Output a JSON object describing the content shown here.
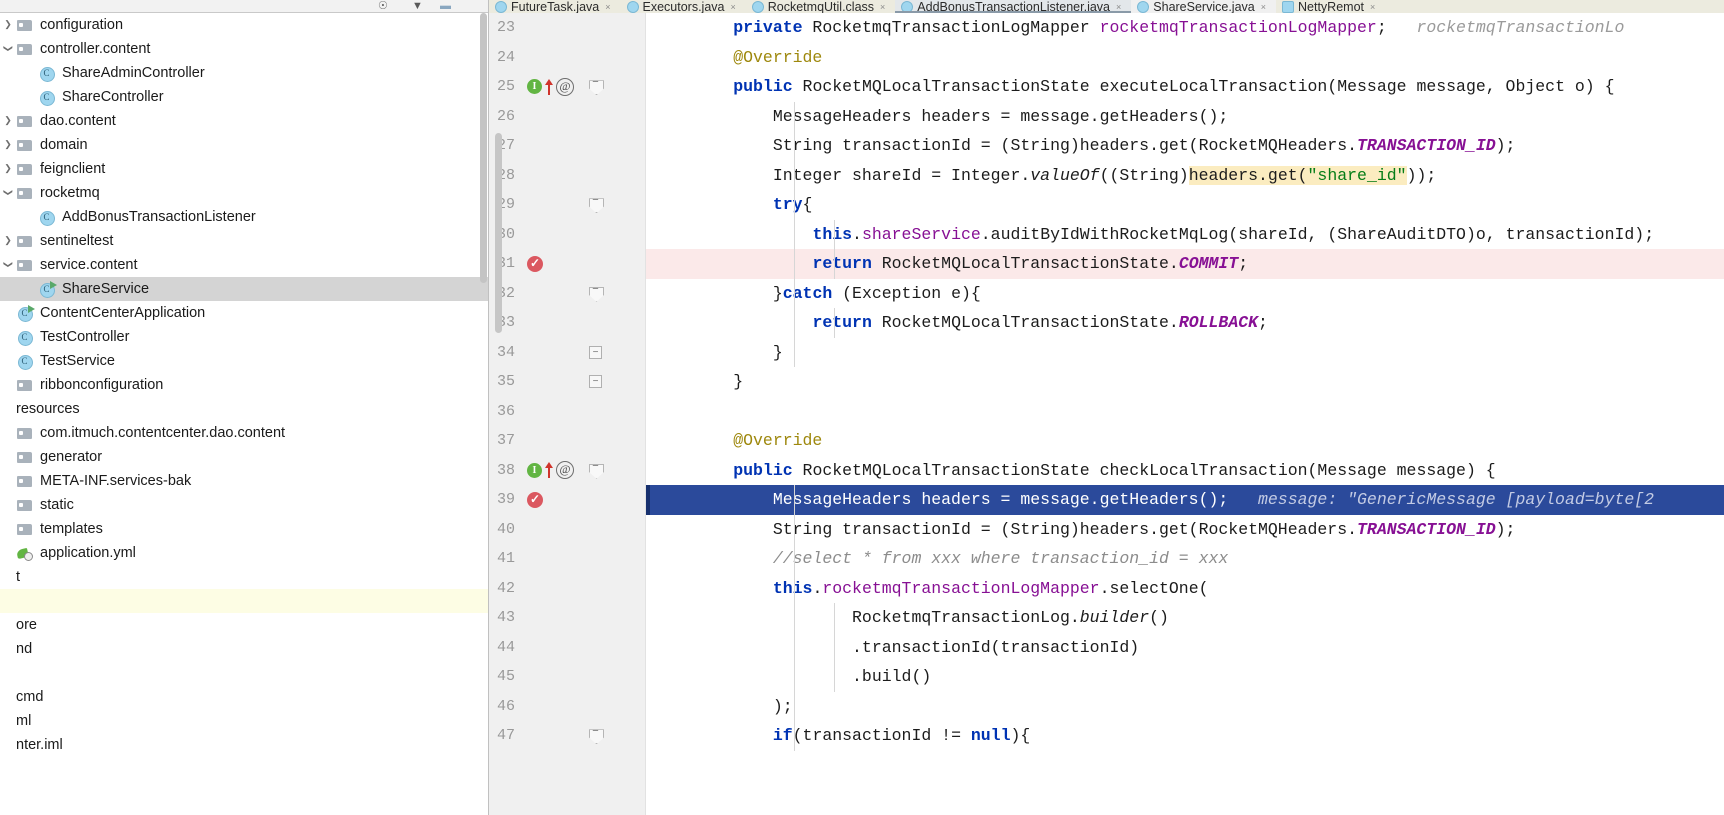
{
  "sidebar": {
    "toolstrip_icons": [
      "collapse-all-icon",
      "settings-icon",
      "hide-icon"
    ],
    "tree": [
      {
        "label": "configuration",
        "icon": "folder-icon",
        "arrow": "right",
        "indent": 1,
        "state": "collapsed"
      },
      {
        "label": "controller.content",
        "icon": "folder-icon",
        "arrow": "down",
        "indent": 1,
        "state": "expanded"
      },
      {
        "label": "ShareAdminController",
        "icon": "class-icon",
        "arrow": "none",
        "indent": 2,
        "state": "leaf"
      },
      {
        "label": "ShareController",
        "icon": "class-icon",
        "arrow": "none",
        "indent": 2,
        "state": "leaf"
      },
      {
        "label": "dao.content",
        "icon": "folder-icon",
        "arrow": "right",
        "indent": 1,
        "state": "collapsed"
      },
      {
        "label": "domain",
        "icon": "folder-icon",
        "arrow": "right",
        "indent": 1,
        "state": "collapsed"
      },
      {
        "label": "feignclient",
        "icon": "folder-icon",
        "arrow": "right",
        "indent": 1,
        "state": "collapsed"
      },
      {
        "label": "rocketmq",
        "icon": "folder-icon",
        "arrow": "down",
        "indent": 1,
        "state": "expanded"
      },
      {
        "label": "AddBonusTransactionListener",
        "icon": "class-icon",
        "arrow": "none",
        "indent": 2,
        "state": "leaf"
      },
      {
        "label": "sentineltest",
        "icon": "folder-icon",
        "arrow": "right",
        "indent": 1,
        "state": "collapsed"
      },
      {
        "label": "service.content",
        "icon": "folder-icon",
        "arrow": "down",
        "indent": 1,
        "state": "expanded"
      },
      {
        "label": "ShareService",
        "icon": "class-runnable-icon",
        "arrow": "none",
        "indent": 2,
        "state": "leaf",
        "selected": true
      },
      {
        "label": "ContentCenterApplication",
        "icon": "class-runnable-icon",
        "arrow": "none",
        "indent": 1,
        "state": "leaf"
      },
      {
        "label": "TestController",
        "icon": "class-icon",
        "arrow": "none",
        "indent": 1,
        "state": "leaf"
      },
      {
        "label": "TestService",
        "icon": "class-icon",
        "arrow": "none",
        "indent": 1,
        "state": "leaf"
      },
      {
        "label": "ribbonconfiguration",
        "icon": "folder-icon",
        "arrow": "none",
        "indent": 0,
        "state": "leaf"
      },
      {
        "label": "resources",
        "icon": "none",
        "arrow": "none",
        "indent": 0,
        "state": "leaf",
        "clipped": true
      },
      {
        "label": "com.itmuch.contentcenter.dao.content",
        "icon": "folder-icon",
        "arrow": "none",
        "indent": 0,
        "state": "leaf"
      },
      {
        "label": "generator",
        "icon": "folder-icon",
        "arrow": "none",
        "indent": 0,
        "state": "leaf"
      },
      {
        "label": "META-INF.services-bak",
        "icon": "folder-icon",
        "arrow": "none",
        "indent": 0,
        "state": "leaf"
      },
      {
        "label": "static",
        "icon": "folder-icon",
        "arrow": "none",
        "indent": 0,
        "state": "leaf"
      },
      {
        "label": "templates",
        "icon": "folder-icon",
        "arrow": "none",
        "indent": 0,
        "state": "leaf"
      },
      {
        "label": "application.yml",
        "icon": "yml-icon",
        "arrow": "none",
        "indent": 0,
        "state": "leaf"
      },
      {
        "label": "t",
        "icon": "none",
        "arrow": "none",
        "indent": 0,
        "state": "leaf",
        "clipped": true
      },
      {
        "label": "",
        "icon": "none",
        "arrow": "none",
        "indent": 0,
        "state": "leaf",
        "highlight": "yellow"
      },
      {
        "label": "ore",
        "icon": "none",
        "arrow": "none",
        "indent": 0,
        "state": "leaf",
        "clipped": true
      },
      {
        "label": "nd",
        "icon": "none",
        "arrow": "none",
        "indent": 0,
        "state": "leaf",
        "clipped": true
      },
      {
        "label": "",
        "icon": "none",
        "arrow": "none",
        "indent": 0,
        "state": "leaf"
      },
      {
        "label": "cmd",
        "icon": "none",
        "arrow": "none",
        "indent": 0,
        "state": "leaf",
        "clipped": true
      },
      {
        "label": "ml",
        "icon": "none",
        "arrow": "none",
        "indent": 0,
        "state": "leaf",
        "clipped": true
      },
      {
        "label": "nter.iml",
        "icon": "none",
        "arrow": "none",
        "indent": 0,
        "state": "leaf",
        "clipped": true
      }
    ]
  },
  "editor": {
    "tabs": [
      {
        "label": "FutureTask.java",
        "icon": "java-class-icon",
        "active": false,
        "style": "yellow"
      },
      {
        "label": "Executors.java",
        "icon": "java-class-icon",
        "active": false,
        "style": "yellow"
      },
      {
        "label": "RocketmqUtil.class",
        "icon": "java-class-icon",
        "active": false,
        "style": "yellow"
      },
      {
        "label": "AddBonusTransactionListener.java",
        "icon": "java-class-icon",
        "active": true,
        "style": "active"
      },
      {
        "label": "ShareService.java",
        "icon": "java-class-icon",
        "active": false,
        "style": "plain"
      },
      {
        "label": "NettyRemot",
        "icon": "java-class-icon",
        "active": false,
        "style": "yellow"
      }
    ],
    "lines": [
      {
        "num": "23",
        "gutter": [],
        "fold": null,
        "indent_guides": [],
        "tokens": [
          {
            "t": "        ",
            "c": "id"
          },
          {
            "t": "private",
            "c": "kw"
          },
          {
            "t": " RocketmqTransactionLogMapper ",
            "c": "id"
          },
          {
            "t": "rocketmqTransactionLogMapper",
            "c": "fld"
          },
          {
            "t": ";",
            "c": "id"
          },
          {
            "t": "   rocketmqTransactionLo",
            "c": "hint"
          }
        ]
      },
      {
        "num": "24",
        "gutter": [],
        "fold": null,
        "indent_guides": [],
        "tokens": [
          {
            "t": "        ",
            "c": "id"
          },
          {
            "t": "@Override",
            "c": "anno"
          }
        ]
      },
      {
        "num": "25",
        "gutter": [
          "implements-icon",
          "up-arrow-icon",
          "at-icon"
        ],
        "fold": "shield",
        "indent_guides": [],
        "tokens": [
          {
            "t": "        ",
            "c": "id"
          },
          {
            "t": "public",
            "c": "kw"
          },
          {
            "t": " RocketMQLocalTransactionState executeLocalTransaction(Message message, Object o) {",
            "c": "id"
          }
        ]
      },
      {
        "num": "26",
        "gutter": [],
        "fold": null,
        "indent_guides": [
          148
        ],
        "tokens": [
          {
            "t": "            MessageHeaders headers = message.getHeaders();",
            "c": "id"
          }
        ]
      },
      {
        "num": "27",
        "gutter": [],
        "fold": null,
        "indent_guides": [
          148
        ],
        "tokens": [
          {
            "t": "            String transactionId = (String)headers.get(RocketMQHeaders.",
            "c": "id"
          },
          {
            "t": "TRANSACTION_ID",
            "c": "stat"
          },
          {
            "t": ");",
            "c": "id"
          }
        ]
      },
      {
        "num": "28",
        "gutter": [],
        "fold": null,
        "indent_guides": [
          148
        ],
        "tokens": [
          {
            "t": "            Integer shareId = Integer.",
            "c": "id"
          },
          {
            "t": "valueOf",
            "c": "ital"
          },
          {
            "t": "((String)",
            "c": "id"
          },
          {
            "t": "headers.get(",
            "c": "hl-id"
          },
          {
            "t": "\"share_id\"",
            "c": "hl-str"
          },
          {
            "t": "));",
            "c": "id"
          }
        ]
      },
      {
        "num": "29",
        "gutter": [],
        "fold": "shield",
        "indent_guides": [
          148
        ],
        "tokens": [
          {
            "t": "            ",
            "c": "id"
          },
          {
            "t": "try",
            "c": "kw"
          },
          {
            "t": "{",
            "c": "id"
          }
        ]
      },
      {
        "num": "30",
        "gutter": [],
        "fold": null,
        "indent_guides": [
          148,
          188
        ],
        "tokens": [
          {
            "t": "                ",
            "c": "id"
          },
          {
            "t": "this",
            "c": "kw"
          },
          {
            "t": ".",
            "c": "id"
          },
          {
            "t": "shareService",
            "c": "fld"
          },
          {
            "t": ".auditByIdWithRocketMqLog(shareId, (ShareAuditDTO)o, transactionId);",
            "c": "id"
          }
        ]
      },
      {
        "num": "31",
        "gutter": [
          "breakpoint-icon"
        ],
        "fold": null,
        "row_style": "breakpoint",
        "indent_guides": [
          148,
          188
        ],
        "tokens": [
          {
            "t": "                ",
            "c": "id"
          },
          {
            "t": "return",
            "c": "kw"
          },
          {
            "t": " RocketMQLocalTransactionState.",
            "c": "id"
          },
          {
            "t": "COMMIT",
            "c": "stat"
          },
          {
            "t": ";",
            "c": "id"
          }
        ]
      },
      {
        "num": "32",
        "gutter": [],
        "fold": "shield",
        "indent_guides": [
          148
        ],
        "tokens": [
          {
            "t": "            }",
            "c": "id"
          },
          {
            "t": "catch",
            "c": "kw"
          },
          {
            "t": " (Exception e){",
            "c": "id"
          }
        ]
      },
      {
        "num": "33",
        "gutter": [],
        "fold": null,
        "indent_guides": [
          148,
          188
        ],
        "tokens": [
          {
            "t": "                ",
            "c": "id"
          },
          {
            "t": "return",
            "c": "kw"
          },
          {
            "t": " RocketMQLocalTransactionState.",
            "c": "id"
          },
          {
            "t": "ROLLBACK",
            "c": "stat"
          },
          {
            "t": ";",
            "c": "id"
          }
        ]
      },
      {
        "num": "34",
        "gutter": [],
        "fold": "plain",
        "indent_guides": [
          148
        ],
        "tokens": [
          {
            "t": "            }",
            "c": "id"
          }
        ]
      },
      {
        "num": "35",
        "gutter": [],
        "fold": "plain",
        "indent_guides": [],
        "tokens": [
          {
            "t": "        }",
            "c": "id"
          }
        ]
      },
      {
        "num": "36",
        "gutter": [],
        "fold": null,
        "indent_guides": [],
        "tokens": []
      },
      {
        "num": "37",
        "gutter": [],
        "fold": null,
        "indent_guides": [],
        "tokens": [
          {
            "t": "        ",
            "c": "id"
          },
          {
            "t": "@Override",
            "c": "anno"
          }
        ]
      },
      {
        "num": "38",
        "gutter": [
          "implements-icon",
          "up-arrow-icon",
          "at-icon"
        ],
        "fold": "shield",
        "indent_guides": [],
        "tokens": [
          {
            "t": "        ",
            "c": "id"
          },
          {
            "t": "public",
            "c": "kw"
          },
          {
            "t": " RocketMQLocalTransactionState checkLocalTransaction(Message message) {",
            "c": "id"
          }
        ]
      },
      {
        "num": "39",
        "gutter": [
          "breakpoint-icon"
        ],
        "fold": null,
        "row_style": "execution",
        "indent_guides": [
          148
        ],
        "tokens": [
          {
            "t": "            MessageHeaders headers = message.getHeaders();",
            "c": "id"
          },
          {
            "t": "   message:",
            "c": "hint"
          },
          {
            "t": " \"GenericMessage [payload=byte[2",
            "c": "hint"
          }
        ]
      },
      {
        "num": "40",
        "gutter": [],
        "fold": null,
        "indent_guides": [
          148
        ],
        "tokens": [
          {
            "t": "            String transactionId = (String)headers.get(RocketMQHeaders.",
            "c": "id"
          },
          {
            "t": "TRANSACTION_ID",
            "c": "stat"
          },
          {
            "t": ");",
            "c": "id"
          }
        ]
      },
      {
        "num": "41",
        "gutter": [],
        "fold": null,
        "indent_guides": [
          148
        ],
        "tokens": [
          {
            "t": "            //select * from xxx where transaction_id = xxx",
            "c": "cmt"
          }
        ]
      },
      {
        "num": "42",
        "gutter": [],
        "fold": null,
        "indent_guides": [
          148
        ],
        "tokens": [
          {
            "t": "            ",
            "c": "id"
          },
          {
            "t": "this",
            "c": "kw"
          },
          {
            "t": ".",
            "c": "id"
          },
          {
            "t": "rocketmqTransactionLogMapper",
            "c": "fld"
          },
          {
            "t": ".selectOne(",
            "c": "id"
          }
        ]
      },
      {
        "num": "43",
        "gutter": [],
        "fold": null,
        "indent_guides": [
          148,
          188
        ],
        "tokens": [
          {
            "t": "                    RocketmqTransactionLog.",
            "c": "id"
          },
          {
            "t": "builder",
            "c": "ital"
          },
          {
            "t": "()",
            "c": "id"
          }
        ]
      },
      {
        "num": "44",
        "gutter": [],
        "fold": null,
        "indent_guides": [
          148,
          188
        ],
        "tokens": [
          {
            "t": "                    .transactionId(transactionId)",
            "c": "id"
          }
        ]
      },
      {
        "num": "45",
        "gutter": [],
        "fold": null,
        "indent_guides": [
          148,
          188
        ],
        "tokens": [
          {
            "t": "                    .build()",
            "c": "id"
          }
        ]
      },
      {
        "num": "46",
        "gutter": [],
        "fold": null,
        "indent_guides": [
          148
        ],
        "tokens": [
          {
            "t": "            );",
            "c": "id"
          }
        ]
      },
      {
        "num": "47",
        "gutter": [],
        "fold": "shield",
        "indent_guides": [
          148
        ],
        "tokens": [
          {
            "t": "            ",
            "c": "id"
          },
          {
            "t": "if",
            "c": "kw"
          },
          {
            "t": "(transactionId != ",
            "c": "id"
          },
          {
            "t": "null",
            "c": "kw"
          },
          {
            "t": "){",
            "c": "id"
          }
        ]
      }
    ]
  },
  "colors": {
    "keyword": "#0033b3",
    "annotation": "#9e880d",
    "string": "#067d17",
    "field": "#871094",
    "static_final": "#871094",
    "comment": "#8c8c8c",
    "inline_hint": "#9a9a9a",
    "execution_line_bg": "#2b4a9b",
    "breakpoint_line_bg": "#fbe9e9",
    "breakpoint": "#db5860",
    "search_highlight": "#fbecc0",
    "selection": "#d4d4d4",
    "tab_bar_bg": "#ecebdf",
    "gutter_bg": "#f0f0f0"
  }
}
